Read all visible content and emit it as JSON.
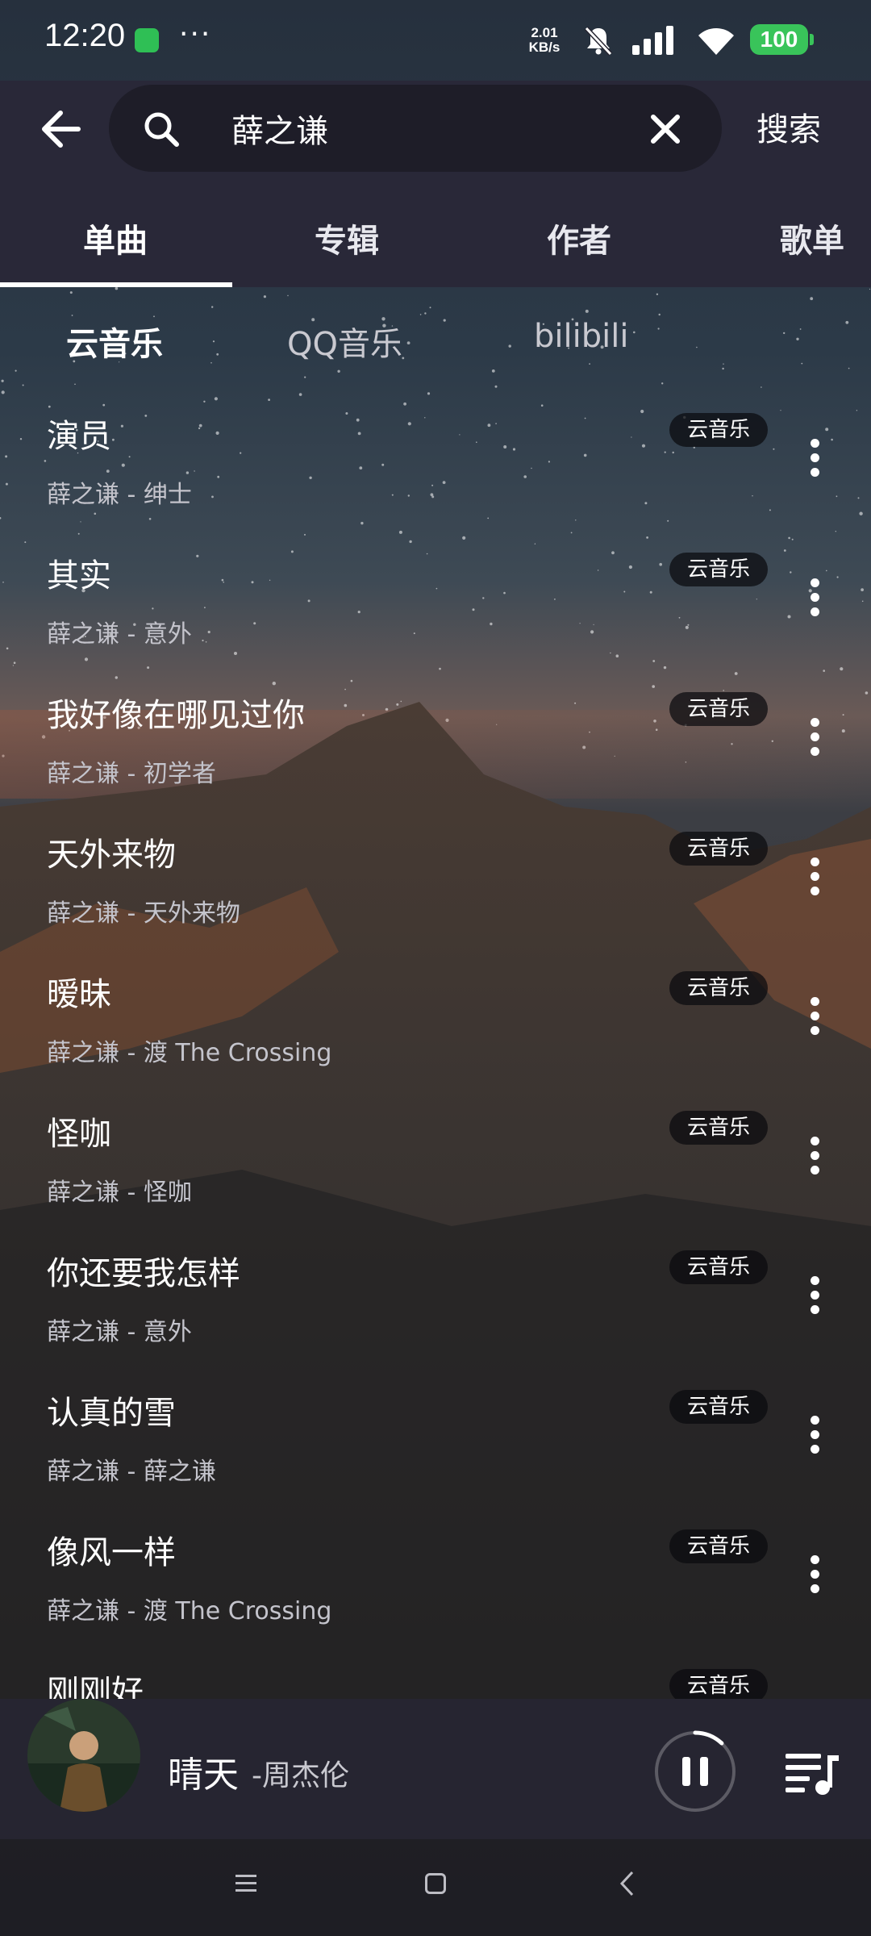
{
  "status_bar": {
    "time": "12:20",
    "more": "···",
    "net_speed_value": "2.01",
    "net_speed_unit": "KB/s",
    "battery": "100",
    "icons": [
      "shield-icon",
      "bell-off-icon",
      "signal-icon",
      "wifi-icon",
      "battery-icon"
    ]
  },
  "search": {
    "query": "薛之谦",
    "submit_label": "搜索"
  },
  "tabs": [
    "单曲",
    "专辑",
    "作者",
    "歌单"
  ],
  "sources": [
    "云音乐",
    "QQ音乐",
    "bilibili"
  ],
  "songs": [
    {
      "title": "演员",
      "subtitle": "薛之谦 - 绅士",
      "source": "云音乐"
    },
    {
      "title": "其实",
      "subtitle": "薛之谦 - 意外",
      "source": "云音乐"
    },
    {
      "title": "我好像在哪见过你",
      "subtitle": "薛之谦 - 初学者",
      "source": "云音乐"
    },
    {
      "title": "天外来物",
      "subtitle": "薛之谦 - 天外来物",
      "source": "云音乐"
    },
    {
      "title": "暧昧",
      "subtitle": "薛之谦 - 渡 The Crossing",
      "source": "云音乐"
    },
    {
      "title": "怪咖",
      "subtitle": "薛之谦 - 怪咖",
      "source": "云音乐"
    },
    {
      "title": "你还要我怎样",
      "subtitle": "薛之谦 - 意外",
      "source": "云音乐"
    },
    {
      "title": "认真的雪",
      "subtitle": "薛之谦 - 薛之谦",
      "source": "云音乐"
    },
    {
      "title": "像风一样",
      "subtitle": "薛之谦 - 渡 The Crossing",
      "source": "云音乐"
    },
    {
      "title": "刚刚好",
      "subtitle": "",
      "source": "云音乐"
    }
  ],
  "now_playing": {
    "title": "晴天",
    "artist": "-周杰伦",
    "state": "playing",
    "progress": 0.12
  },
  "colors": {
    "background": "#262531",
    "accent": "#ffffff",
    "battery": "#39c45a"
  }
}
